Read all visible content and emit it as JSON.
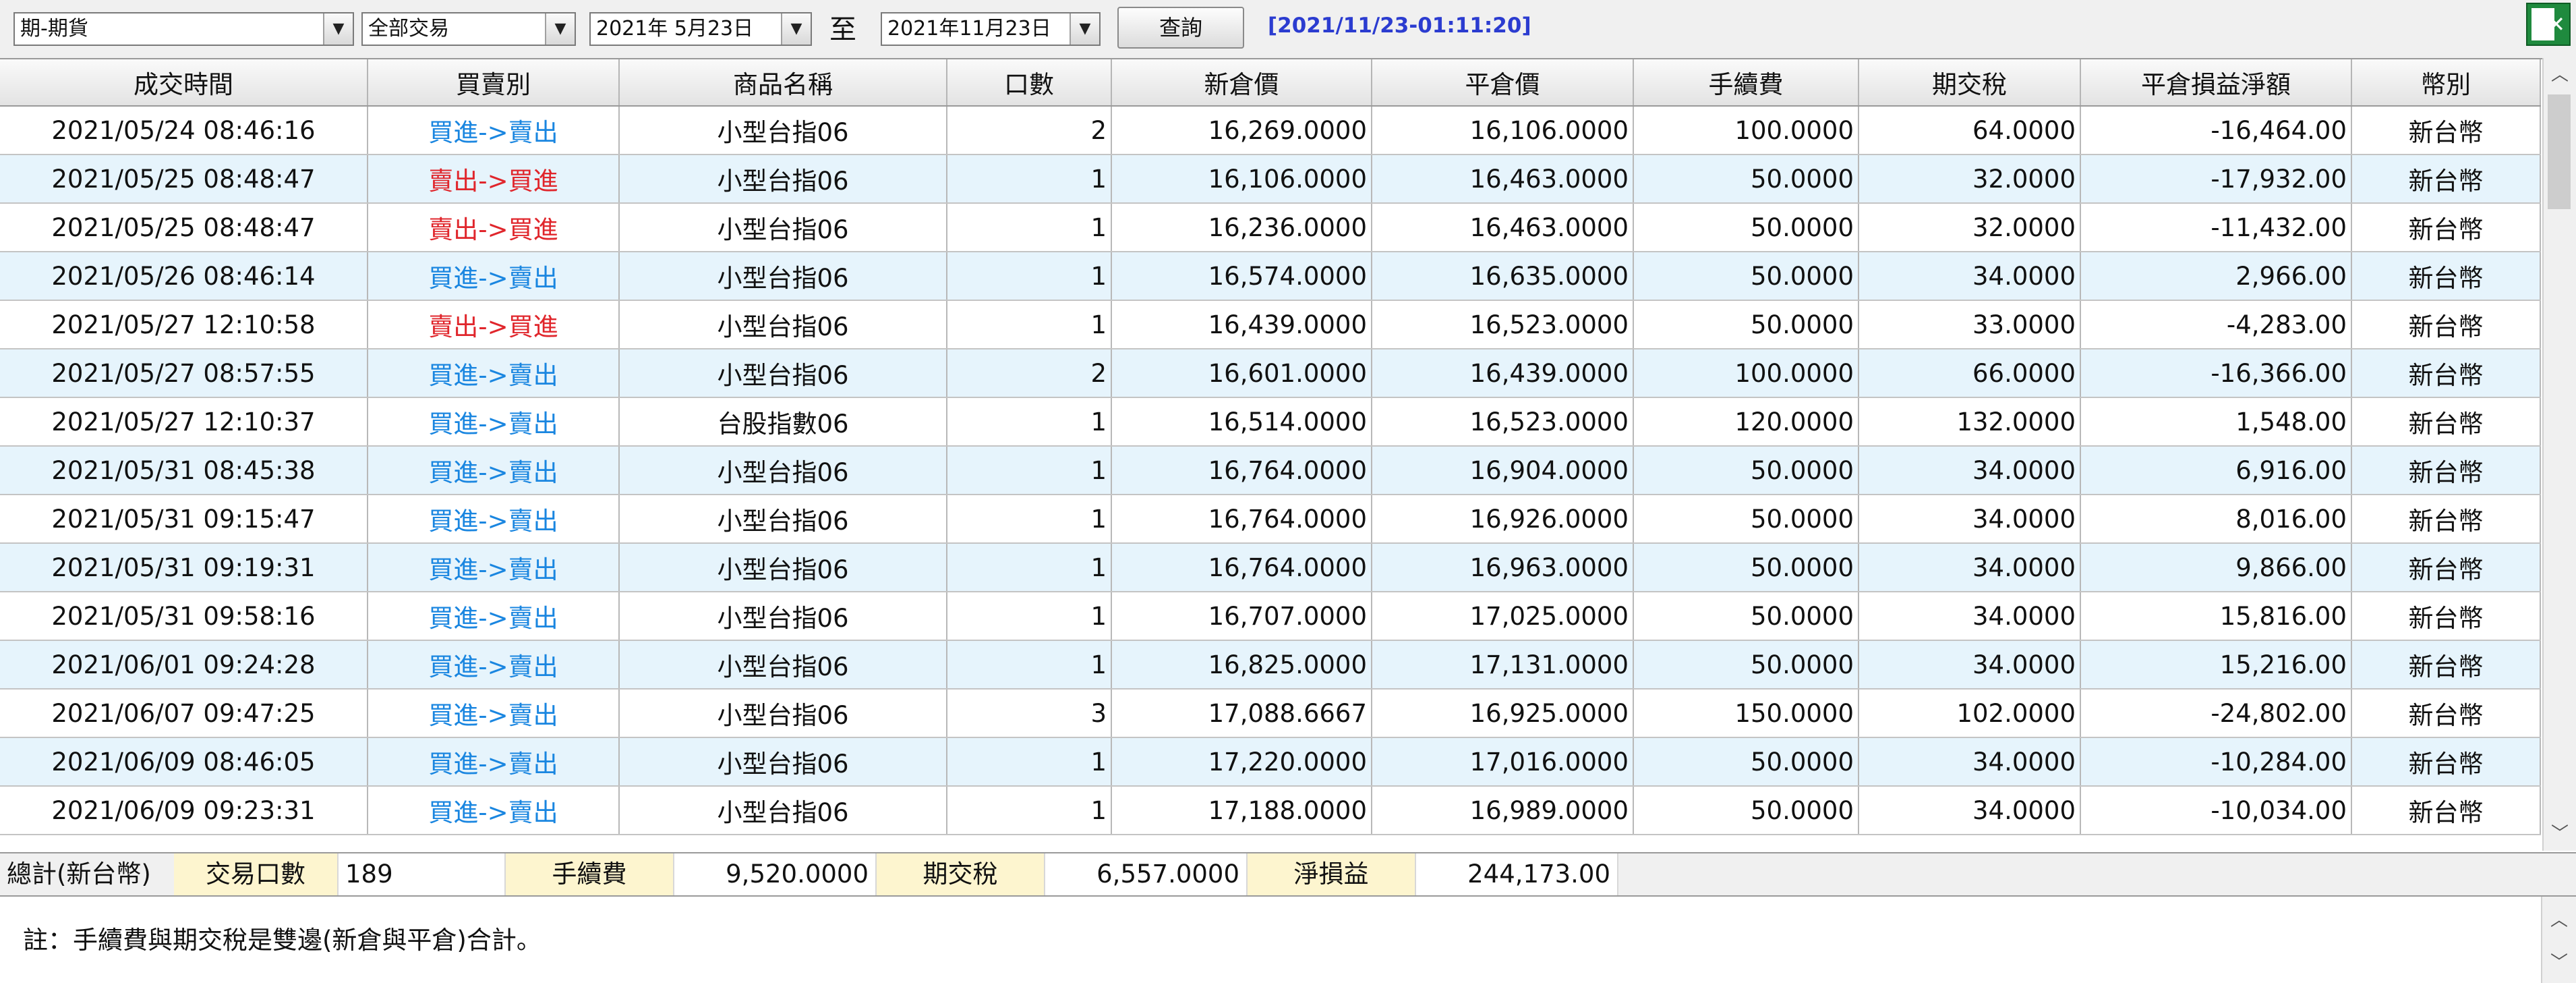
{
  "toolbar": {
    "market_select": "期-期貨",
    "trade_type_select": "全部交易",
    "date_from": "2021年 5月23日",
    "to_label": "至",
    "date_to": "2021年11月23日",
    "query_button": "查詢",
    "query_stamp": "[2021/11/23-01:11:20]",
    "export_icon": "excel-export-icon"
  },
  "table": {
    "headers": [
      "成交時間",
      "買賣別",
      "商品名稱",
      "口數",
      "新倉價",
      "平倉價",
      "手續費",
      "期交稅",
      "平倉損益淨額",
      "幣別"
    ],
    "rows": [
      [
        "2021/05/24 08:46:16",
        "買進->賣出",
        "小型台指06",
        "2",
        "16,269.0000",
        "16,106.0000",
        "100.0000",
        "64.0000",
        "-16,464.00",
        "新台幣"
      ],
      [
        "2021/05/25 08:48:47",
        "賣出->買進",
        "小型台指06",
        "1",
        "16,106.0000",
        "16,463.0000",
        "50.0000",
        "32.0000",
        "-17,932.00",
        "新台幣"
      ],
      [
        "2021/05/25 08:48:47",
        "賣出->買進",
        "小型台指06",
        "1",
        "16,236.0000",
        "16,463.0000",
        "50.0000",
        "32.0000",
        "-11,432.00",
        "新台幣"
      ],
      [
        "2021/05/26 08:46:14",
        "買進->賣出",
        "小型台指06",
        "1",
        "16,574.0000",
        "16,635.0000",
        "50.0000",
        "34.0000",
        "2,966.00",
        "新台幣"
      ],
      [
        "2021/05/27 12:10:58",
        "賣出->買進",
        "小型台指06",
        "1",
        "16,439.0000",
        "16,523.0000",
        "50.0000",
        "33.0000",
        "-4,283.00",
        "新台幣"
      ],
      [
        "2021/05/27 08:57:55",
        "買進->賣出",
        "小型台指06",
        "2",
        "16,601.0000",
        "16,439.0000",
        "100.0000",
        "66.0000",
        "-16,366.00",
        "新台幣"
      ],
      [
        "2021/05/27 12:10:37",
        "買進->賣出",
        "台股指數06",
        "1",
        "16,514.0000",
        "16,523.0000",
        "120.0000",
        "132.0000",
        "1,548.00",
        "新台幣"
      ],
      [
        "2021/05/31 08:45:38",
        "買進->賣出",
        "小型台指06",
        "1",
        "16,764.0000",
        "16,904.0000",
        "50.0000",
        "34.0000",
        "6,916.00",
        "新台幣"
      ],
      [
        "2021/05/31 09:15:47",
        "買進->賣出",
        "小型台指06",
        "1",
        "16,764.0000",
        "16,926.0000",
        "50.0000",
        "34.0000",
        "8,016.00",
        "新台幣"
      ],
      [
        "2021/05/31 09:19:31",
        "買進->賣出",
        "小型台指06",
        "1",
        "16,764.0000",
        "16,963.0000",
        "50.0000",
        "34.0000",
        "9,866.00",
        "新台幣"
      ],
      [
        "2021/05/31 09:58:16",
        "買進->賣出",
        "小型台指06",
        "1",
        "16,707.0000",
        "17,025.0000",
        "50.0000",
        "34.0000",
        "15,816.00",
        "新台幣"
      ],
      [
        "2021/06/01 09:24:28",
        "買進->賣出",
        "小型台指06",
        "1",
        "16,825.0000",
        "17,131.0000",
        "50.0000",
        "34.0000",
        "15,216.00",
        "新台幣"
      ],
      [
        "2021/06/07 09:47:25",
        "買進->賣出",
        "小型台指06",
        "3",
        "17,088.6667",
        "16,925.0000",
        "150.0000",
        "102.0000",
        "-24,802.00",
        "新台幣"
      ],
      [
        "2021/06/09 08:46:05",
        "買進->賣出",
        "小型台指06",
        "1",
        "17,220.0000",
        "17,016.0000",
        "50.0000",
        "34.0000",
        "-10,284.00",
        "新台幣"
      ],
      [
        "2021/06/09 09:23:31",
        "買進->賣出",
        "小型台指06",
        "1",
        "17,188.0000",
        "16,989.0000",
        "50.0000",
        "34.0000",
        "-10,034.00",
        "新台幣"
      ]
    ]
  },
  "summary": {
    "title": "總計(新台幣)",
    "lots_label": "交易口數",
    "lots_value": "189",
    "fee_label": "手續費",
    "fee_value": "9,520.0000",
    "tax_label": "期交稅",
    "tax_value": "6,557.0000",
    "net_label": "淨損益",
    "net_value": "244,173.00"
  },
  "note": {
    "text": "註：手續費與期交稅是雙邊(新倉與平倉)合計。"
  },
  "colors": {
    "buy_text": "#1a86e0",
    "sell_text": "#e0262c",
    "alt_row": "#e6f4fc",
    "summary_label_bg": "#fdf5cf",
    "stamp_text": "#2b3cd0"
  }
}
